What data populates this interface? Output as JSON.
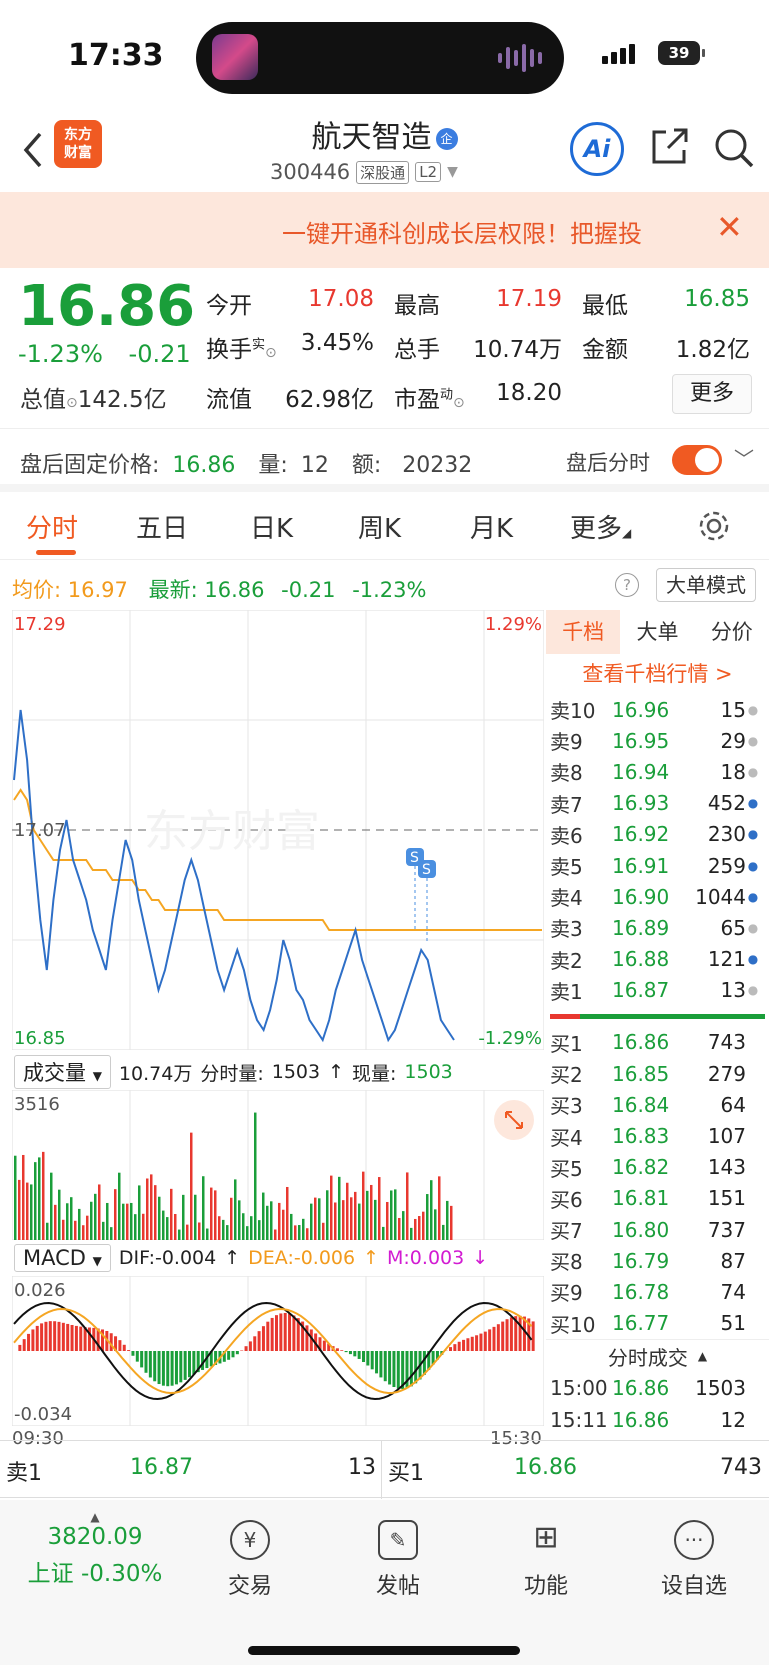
{
  "status": {
    "time": "17:33",
    "battery": "39"
  },
  "header": {
    "logo": "东方\n财富",
    "stock_name": "航天智造",
    "qi_badge": "企",
    "code": "300446",
    "tag1": "深股通",
    "tag2": "L2",
    "ai": "Ai"
  },
  "banner": {
    "text": "一键开通科创成长层权限！把握投"
  },
  "quote": {
    "price": "16.86",
    "change_pct": "-1.23%",
    "change": "-0.21",
    "open_label": "今开",
    "open": "17.08",
    "high_label": "最高",
    "high": "17.19",
    "low_label": "最低",
    "low": "16.85",
    "turnover_label": "换手",
    "turnover_sup": "实",
    "turnover": "3.45%",
    "volume_label": "总手",
    "volume": "10.74万",
    "amount_label": "金额",
    "amount": "1.82亿",
    "mktcap_label": "总值",
    "mktcap": "142.5亿",
    "float_label": "流值",
    "float": "62.98亿",
    "pe_label": "市盈",
    "pe_sup": "动",
    "pe": "18.20",
    "more": "更多"
  },
  "after_hours": {
    "label": "盘后固定价格:",
    "price": "16.86",
    "vol_label": "量:",
    "vol": "12",
    "amt_label": "额:",
    "amt": "20232",
    "toggle_label": "盘后分时"
  },
  "tabs": [
    "分时",
    "五日",
    "日K",
    "周K",
    "月K",
    "更多"
  ],
  "info": {
    "avg_label": "均价:",
    "avg": "16.97",
    "last_label": "最新:",
    "last": "16.86",
    "chg": "-0.21",
    "pct": "-1.23%",
    "big_mode": "大单模式",
    "help": "?"
  },
  "chart_data": {
    "type": "line",
    "title": "",
    "y_top": "17.29",
    "y_bottom": "16.85",
    "y_ref": "17.07",
    "pct_top": "1.29%",
    "pct_bottom": "-1.29%",
    "x_start": "09:30",
    "x_end": "15:30",
    "watermark": "东方财富",
    "ylim": [
      16.85,
      17.29
    ],
    "series": [
      {
        "name": "price",
        "values": [
          17.12,
          17.19,
          17.14,
          17.05,
          16.98,
          16.93,
          17.0,
          17.05,
          17.08,
          17.04,
          17.02,
          17.0,
          16.97,
          16.95,
          16.93,
          16.98,
          17.02,
          17.06,
          17.04,
          17.0,
          16.97,
          16.94,
          16.91,
          16.93,
          16.96,
          16.99,
          17.02,
          17.04,
          17.02,
          16.99,
          16.96,
          16.93,
          16.91,
          16.93,
          16.95,
          16.93,
          16.9,
          16.88,
          16.87,
          16.89,
          16.92,
          16.96,
          16.94,
          16.91,
          16.9,
          16.88,
          16.87,
          16.86,
          16.88,
          16.91,
          16.93,
          16.95,
          16.97,
          16.94,
          16.92,
          16.9,
          16.88,
          16.86,
          16.87,
          16.89,
          16.91,
          16.93,
          16.95,
          16.94,
          16.91,
          16.88,
          16.87,
          16.86
        ]
      },
      {
        "name": "avg",
        "values": [
          17.1,
          17.11,
          17.1,
          17.07,
          17.06,
          17.05,
          17.04,
          17.04,
          17.04,
          17.04,
          17.04,
          17.04,
          17.03,
          17.03,
          17.03,
          17.02,
          17.02,
          17.02,
          17.02,
          17.01,
          17.01,
          17.0,
          17.0,
          16.99,
          16.99,
          16.99,
          16.99,
          16.99,
          16.99,
          16.99,
          16.99,
          16.99,
          16.98,
          16.98,
          16.98,
          16.98,
          16.98,
          16.98,
          16.98,
          16.98,
          16.98,
          16.98,
          16.98,
          16.98,
          16.98,
          16.98,
          16.98,
          16.98,
          16.97,
          16.97,
          16.97,
          16.97,
          16.97,
          16.97,
          16.97,
          16.97,
          16.97,
          16.97,
          16.97,
          16.97,
          16.97,
          16.97,
          16.97,
          16.97,
          16.97,
          16.97,
          16.97,
          16.97
        ]
      }
    ]
  },
  "volume_panel": {
    "selector": "成交量",
    "total": "10.74万",
    "tick_label": "分时量:",
    "tick": "1503",
    "now_label": "现量:",
    "now": "1503",
    "max": "3516"
  },
  "macd_panel": {
    "selector": "MACD",
    "dif": "DIF:-0.004",
    "dea": "DEA:-0.006",
    "m": "M:0.003",
    "top": "0.026",
    "bottom": "-0.034"
  },
  "orderbook": {
    "tabs": [
      "千档",
      "大单",
      "分价"
    ],
    "link": "查看千档行情 >",
    "asks": [
      {
        "label": "卖10",
        "price": "16.96",
        "vol": "15",
        "dot": "gray"
      },
      {
        "label": "卖9",
        "price": "16.95",
        "vol": "29",
        "dot": "gray"
      },
      {
        "label": "卖8",
        "price": "16.94",
        "vol": "18",
        "dot": "gray"
      },
      {
        "label": "卖7",
        "price": "16.93",
        "vol": "452",
        "dot": "blue"
      },
      {
        "label": "卖6",
        "price": "16.92",
        "vol": "230",
        "dot": "blue"
      },
      {
        "label": "卖5",
        "price": "16.91",
        "vol": "259",
        "dot": "blue"
      },
      {
        "label": "卖4",
        "price": "16.90",
        "vol": "1044",
        "dot": "blue"
      },
      {
        "label": "卖3",
        "price": "16.89",
        "vol": "65",
        "dot": "gray"
      },
      {
        "label": "卖2",
        "price": "16.88",
        "vol": "121",
        "dot": "blue"
      },
      {
        "label": "卖1",
        "price": "16.87",
        "vol": "13",
        "dot": "gray"
      }
    ],
    "bids": [
      {
        "label": "买1",
        "price": "16.86",
        "vol": "743"
      },
      {
        "label": "买2",
        "price": "16.85",
        "vol": "279"
      },
      {
        "label": "买3",
        "price": "16.84",
        "vol": "64"
      },
      {
        "label": "买4",
        "price": "16.83",
        "vol": "107"
      },
      {
        "label": "买5",
        "price": "16.82",
        "vol": "143"
      },
      {
        "label": "买6",
        "price": "16.81",
        "vol": "151"
      },
      {
        "label": "买7",
        "price": "16.80",
        "vol": "737"
      },
      {
        "label": "买8",
        "price": "16.79",
        "vol": "87"
      },
      {
        "label": "买9",
        "price": "16.78",
        "vol": "74"
      },
      {
        "label": "买10",
        "price": "16.77",
        "vol": "51"
      }
    ],
    "trades_title": "分时成交",
    "trades": [
      {
        "time": "15:00",
        "price": "16.86",
        "vol": "1503"
      },
      {
        "time": "15:11",
        "price": "16.86",
        "vol": "12"
      }
    ]
  },
  "footer_bar": {
    "sell_label": "卖1",
    "sell_price": "16.87",
    "sell_vol": "13",
    "buy_label": "买1",
    "buy_price": "16.86",
    "buy_vol": "743"
  },
  "nav": {
    "index_value": "3820.09",
    "index_label": "上证 -0.30%",
    "items": [
      "交易",
      "发帖",
      "功能",
      "设自选"
    ]
  }
}
